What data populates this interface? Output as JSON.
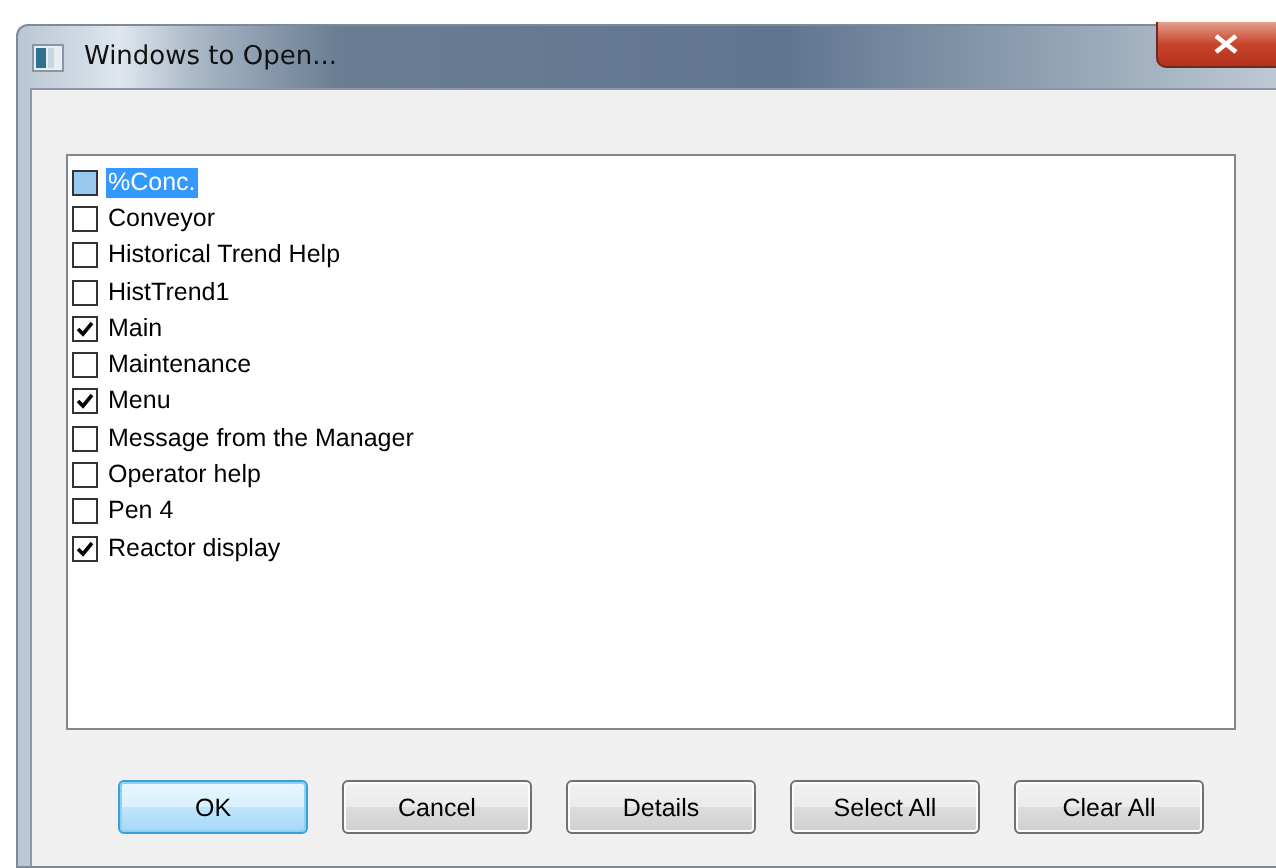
{
  "window": {
    "title": "Windows to Open..."
  },
  "items": [
    {
      "label": "%Conc.",
      "checked": false,
      "selected": true
    },
    {
      "label": "Conveyor",
      "checked": false,
      "selected": false
    },
    {
      "label": "Historical Trend Help",
      "checked": false,
      "selected": false
    },
    {
      "label": "HistTrend1",
      "checked": false,
      "selected": false
    },
    {
      "label": "Main",
      "checked": true,
      "selected": false
    },
    {
      "label": "Maintenance",
      "checked": false,
      "selected": false
    },
    {
      "label": "Menu",
      "checked": true,
      "selected": false
    },
    {
      "label": "Message from the Manager",
      "checked": false,
      "selected": false
    },
    {
      "label": "Operator help",
      "checked": false,
      "selected": false
    },
    {
      "label": "Pen 4",
      "checked": false,
      "selected": false
    },
    {
      "label": "Reactor display",
      "checked": true,
      "selected": false
    }
  ],
  "buttons": [
    {
      "label": "OK",
      "default": true
    },
    {
      "label": "Cancel",
      "default": false
    },
    {
      "label": "Details",
      "default": false
    },
    {
      "label": "Select All",
      "default": false
    },
    {
      "label": "Clear All",
      "default": false
    }
  ]
}
